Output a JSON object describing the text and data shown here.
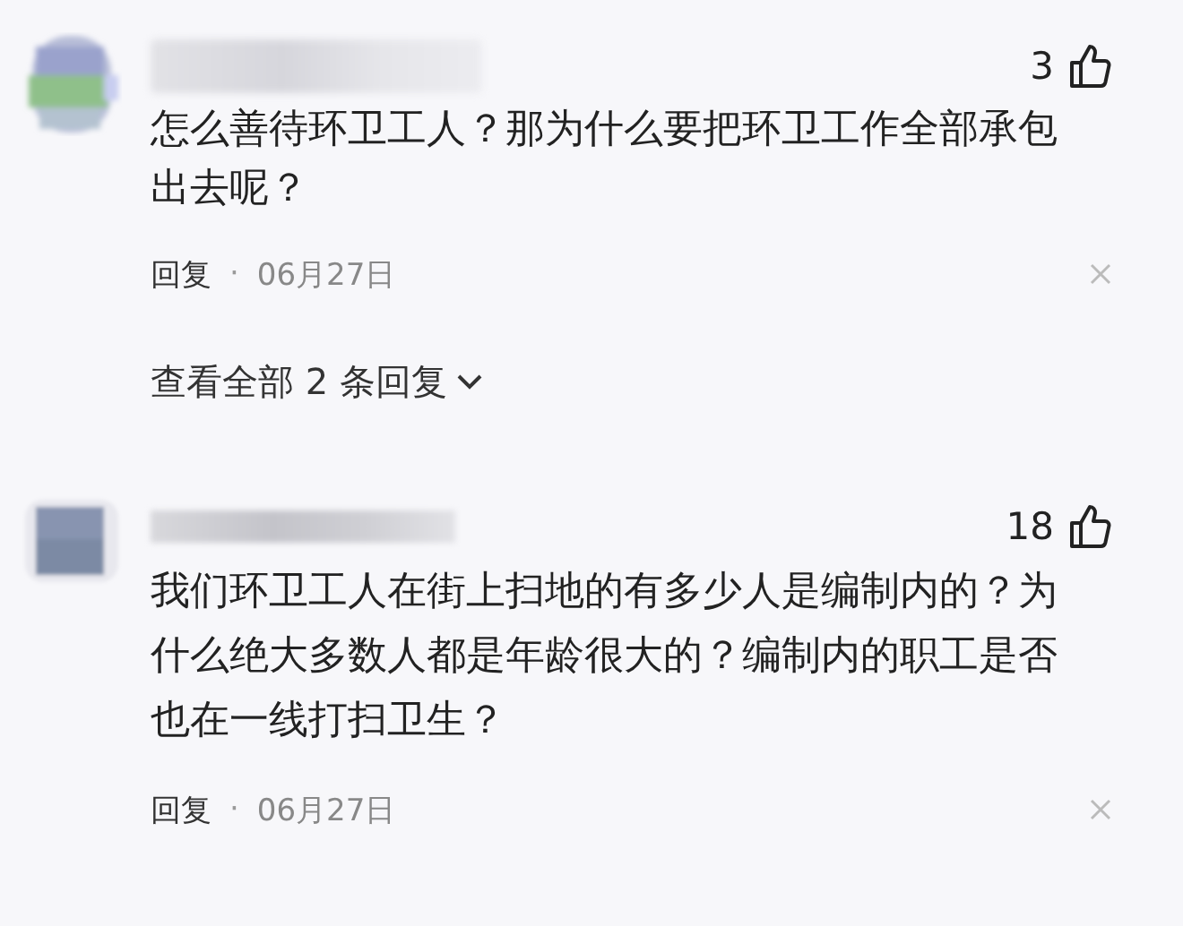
{
  "comments": [
    {
      "avatar": {
        "kind": "mosaic"
      },
      "likes": "3",
      "text": "怎么善待环卫工人？那为什么要把环卫工作全部承包出去呢？",
      "reply_label": "回复",
      "separator": "·",
      "date": "06月27日",
      "view_replies": "查看全部 2 条回复"
    },
    {
      "avatar": {
        "kind": "square"
      },
      "likes": "18",
      "text": "我们环卫工人在街上扫地的有多少人是编制内的？为什么绝大多数人都是年龄很大的？编制内的职工是否也在一线打扫卫生？",
      "reply_label": "回复",
      "separator": "·",
      "date": "06月27日"
    }
  ]
}
